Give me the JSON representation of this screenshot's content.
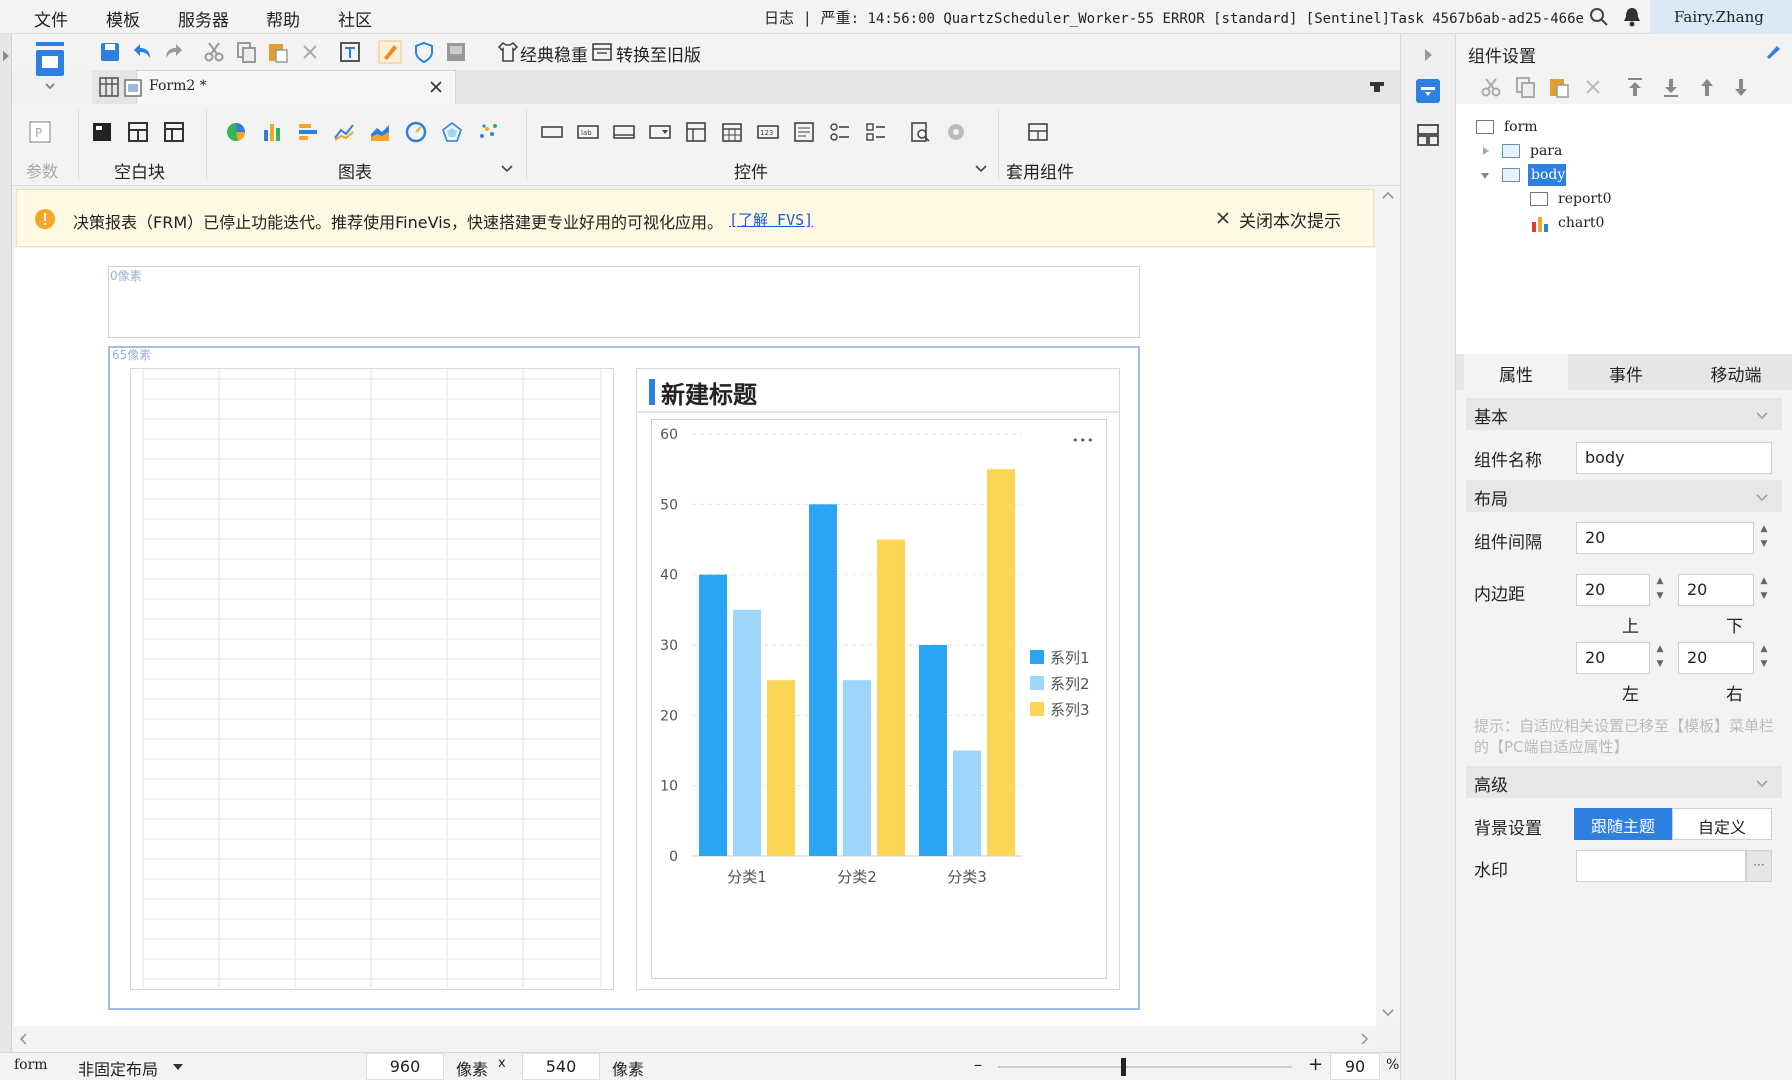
{
  "menu": [
    "文件",
    "模板",
    "服务器",
    "帮助",
    "社区"
  ],
  "log": {
    "label": "日志",
    "separator": "|",
    "severity": "严重",
    "message": ": 14:56:00 QuartzScheduler_Worker-55 ERROR [standard] [Sentinel]Task 4567b6ab-ad25-466e..."
  },
  "user": "Fairy.Zhang",
  "toolbar": {
    "classic_label": "经典稳重",
    "convert_label": "转换至旧版"
  },
  "doc_tab": {
    "name": "Form2 *"
  },
  "ribbon": {
    "param_label": "参数",
    "blank_label": "空白块",
    "chart_label": "图表",
    "widget_label": "控件",
    "package_label": "套用组件"
  },
  "notice": {
    "text": "决策报表（FRM）已停止功能迭代。推荐使用FineVis，快速搭建更专业好用的可视化应用。",
    "link": "[了解 FVS]",
    "close_label": "关闭本次提示"
  },
  "canvas": {
    "top_ruler": "0像素",
    "body_ruler": "65像素"
  },
  "chart": {
    "title": "新建标题",
    "more_label": "•••"
  },
  "chart_data": {
    "type": "bar",
    "title": "新建标题",
    "categories": [
      "分类1",
      "分类2",
      "分类3"
    ],
    "series": [
      {
        "name": "系列1",
        "values": [
          40,
          50,
          30
        ],
        "color": "#2aa5f3"
      },
      {
        "name": "系列2",
        "values": [
          35,
          25,
          15
        ],
        "color": "#9dd6fb"
      },
      {
        "name": "系列3",
        "values": [
          25,
          45,
          55
        ],
        "color": "#fbd556"
      }
    ],
    "ylim": [
      0,
      60
    ],
    "yticks": [
      "0",
      "10",
      "20",
      "30",
      "40",
      "50",
      "60"
    ],
    "legend": "right",
    "grid": true
  },
  "status": {
    "layout_name": "form",
    "layout_mode": "非固定布局",
    "width": "960",
    "unit1": "像素",
    "times": "x",
    "height": "540",
    "unit2": "像素",
    "minus": "–",
    "plus": "+",
    "zoom": "90",
    "percent": "%"
  },
  "panel": {
    "title": "组件设置",
    "tree": [
      "form",
      "para",
      "body",
      "report0",
      "chart0"
    ],
    "tabs": [
      "属性",
      "事件",
      "移动端"
    ],
    "section_basic": "基本",
    "name_label": "组件名称",
    "name_value": "body",
    "section_layout": "布局",
    "gap_label": "组件间隔",
    "gap_value": "20",
    "padding_label": "内边距",
    "pad_top": "20",
    "pad_bottom": "20",
    "pad_left": "20",
    "pad_right": "20",
    "top_label": "上",
    "bottom_label": "下",
    "left_label": "左",
    "right_label": "右",
    "hint": "提示：自适应相关设置已移至【模板】菜单栏的【PC端自适应属性】",
    "section_advanced": "高级",
    "bg_label": "背景设置",
    "bg_theme": "跟随主题",
    "bg_custom": "自定义",
    "watermark_label": "水印",
    "watermark_more": "···"
  },
  "colors": {
    "accent": "#2d7fe0",
    "notice_icon": "#f5a623",
    "frame": "#9dc1e6"
  }
}
